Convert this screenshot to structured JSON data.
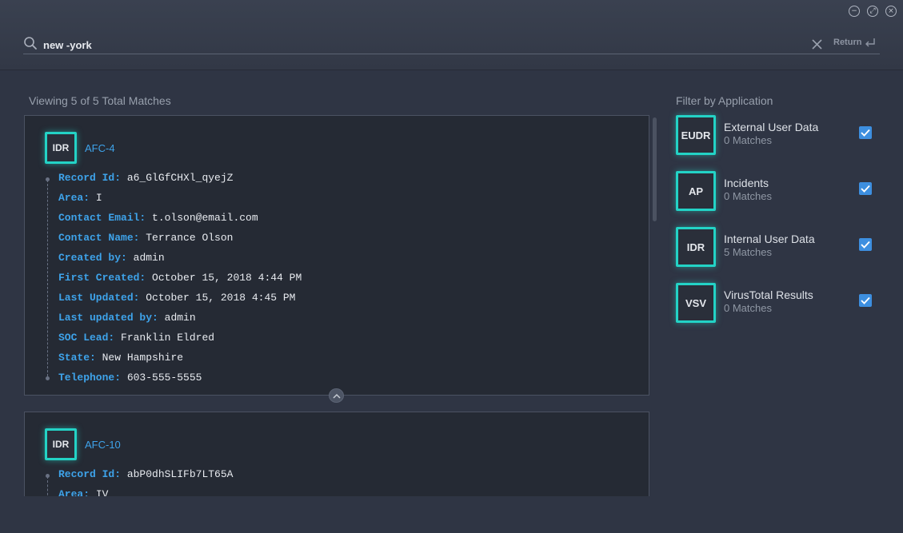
{
  "window": {
    "minimize_symbol": "−",
    "restore_symbol": "⤢",
    "close_symbol": "×"
  },
  "search": {
    "query": "new -york",
    "return_label": "Return"
  },
  "results": {
    "viewing_text": "Viewing 5 of 5 Total Matches",
    "cards": [
      {
        "app": "IDR",
        "record": "AFC-4",
        "fields": [
          {
            "key": "Record Id:",
            "value": "a6_GlGfCHXl_qyejZ"
          },
          {
            "key": "Area:",
            "value": "I"
          },
          {
            "key": "Contact Email:",
            "value": "t.olson@email.com"
          },
          {
            "key": "Contact Name:",
            "value": "Terrance Olson"
          },
          {
            "key": "Created by:",
            "value": "admin"
          },
          {
            "key": "First Created:",
            "value": "October 15, 2018 4:44 PM"
          },
          {
            "key": "Last Updated:",
            "value": "October 15, 2018 4:45 PM"
          },
          {
            "key": "Last updated by:",
            "value": "admin"
          },
          {
            "key": "SOC Lead:",
            "value": "Franklin Eldred"
          },
          {
            "key": "State:",
            "value": "New Hampshire"
          },
          {
            "key": "Telephone:",
            "value": "603-555-5555"
          }
        ]
      },
      {
        "app": "IDR",
        "record": "AFC-10",
        "fields": [
          {
            "key": "Record Id:",
            "value": "abP0dhSLIFb7LT65A"
          },
          {
            "key": "Area:",
            "value": "IV"
          }
        ]
      }
    ]
  },
  "filter": {
    "title": "Filter by Application",
    "items": [
      {
        "code": "EUDR",
        "name": "External User Data",
        "matches": "0 Matches",
        "checked": true
      },
      {
        "code": "AP",
        "name": "Incidents",
        "matches": "0 Matches",
        "checked": true
      },
      {
        "code": "IDR",
        "name": "Internal User Data",
        "matches": "5 Matches",
        "checked": true
      },
      {
        "code": "VSV",
        "name": "VirusTotal Results",
        "matches": "0 Matches",
        "checked": true
      }
    ]
  },
  "colors": {
    "accent_teal": "#23d3c6",
    "field_key_blue": "#3ea3ea",
    "checkbox_blue": "#3d8fe0",
    "background": "#2f3544",
    "card_background": "#252a34"
  },
  "icons": [
    "search-icon",
    "clear-icon",
    "return-icon",
    "minimize-icon",
    "restore-icon",
    "close-icon",
    "chevron-up-icon",
    "checkmark-icon"
  ]
}
